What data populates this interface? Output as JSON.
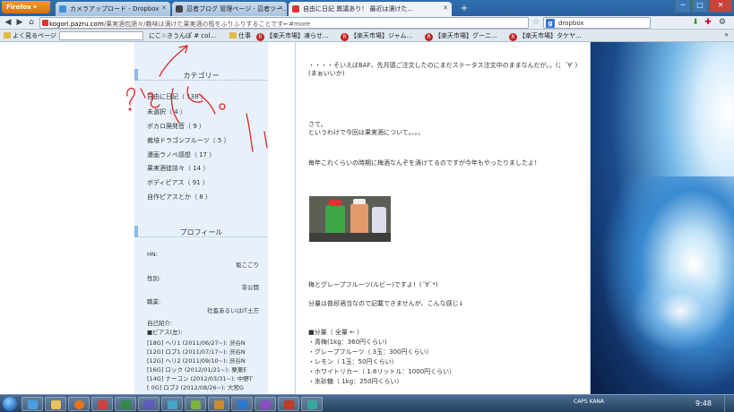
{
  "browser": {
    "menu_label": "Firefox",
    "tabs": [
      {
        "label": "カメラアップロード - Dropbox",
        "state": "bg"
      },
      {
        "label": "忍者ブログ 管理ページ - 忍者ツー...",
        "state": "bg"
      },
      {
        "label": "自由に日記 異議あり！ 最近は漬けた...",
        "state": "active"
      }
    ],
    "new_tab": "+",
    "window_buttons": [
      "─",
      "□",
      "✕"
    ]
  },
  "navbar": {
    "url_domain": "kogori.pazru.com",
    "url_rest": "/果実酒包諦々/趣味は漬けた果実酒の瓶をふりふりすることです←#more",
    "search_text": "dropbox"
  },
  "bookmarks": [
    {
      "label": "よく見るページ",
      "type": "plain"
    },
    {
      "label": "にこ☆きうんぽ # col...",
      "type": "plain"
    },
    {
      "label": "仕事",
      "type": "folder"
    },
    {
      "label": "【楽天市場】凍らせ...",
      "type": "rakuten"
    },
    {
      "label": "【楽天市場】ジャム...",
      "type": "rakuten"
    },
    {
      "label": "【楽天市場】グーニ...",
      "type": "rakuten"
    },
    {
      "label": "【楽天市場】タケヤ...",
      "type": "rakuten"
    }
  ],
  "sidebar": {
    "category_title": "カテゴリー",
    "categories": [
      "自由に日記（ 138 ）",
      "未選択（ 4 ）",
      "ボカロ廃発音（ 9 ）",
      "裁培ドラゴンフルーツ（ 5 ）",
      "漫画ラノベ感想（ 17 ）",
      "果実酒徒誌々（ 14 ）",
      "ボディピアス（ 91 ）",
      "自作ピアスとか（ 8 ）"
    ],
    "profile_title": "プロフィール",
    "profile": {
      "hn_label": "HN:",
      "hn_value": "坂こごり",
      "sex_label": "性別:",
      "sex_value": "非公開",
      "job_label": "職業:",
      "job_value": "社畜あるいはIT土方",
      "intro_label": "自己紹介:",
      "piercing_label": "■ピアス(左):",
      "piercings": [
        {
          "left": "[18G] ヘリ1 (2011/06/27~):",
          "right": "渋谷N"
        },
        {
          "left": "[12G] ロブ1 (2011/07/17~):",
          "right": "渋谷N"
        },
        {
          "left": "[12G] ヘリ2 (2011/09/10~):",
          "right": "渋谷N"
        },
        {
          "left": "[16G] ロック (2012/01/21~):",
          "right": "栗東E"
        },
        {
          "left": "[14G] ナーコン (2012/03/31~):",
          "right": "中野T"
        },
        {
          "left": "[ 0G] ロブ2 (2012/08/26~):",
          "right": "大宮G"
        }
      ]
    }
  },
  "content": {
    "lines_top": [
      "・・・・そいえばBAF、先月頭ご注文したのにまだステータス注文中のままなんだが。。(；´∀`)",
      "(まぁいいか)"
    ],
    "lines_mid": [
      "さて。",
      "というわけで今回は果実酒について。。。。"
    ],
    "line_intro": "毎年これくらいの時期に梅酒なんぞを漬けてるのですが今年もやったりましたよ！",
    "photo_caption": "梅とグレープフルーツ(ルビー)ですよ！(´∀`*)",
    "line_note": "分量は普段適当なので記載できませんが、こんな感じ↓",
    "amount_title": "■分量（ 全量 ← ）",
    "amounts": [
      "・青梅(1kg：360円くらい)",
      "・グレープフルーツ（ 3玉：300円くらい）",
      "・レモン（ 1玉：50円くらい）",
      "・ホワイトリカー（ 1.8リットル：1000円くらい）",
      "・氷砂糖（ 1kg：250円くらい）"
    ]
  },
  "taskbar": {
    "tray_text": "CAPS KANA",
    "clock": "9:48"
  },
  "colors": {
    "sidebar_bg": "#e8f1fb",
    "accent": "#8fb8e2",
    "scribble": "#e02020",
    "titlebar": "#2f6fb0"
  }
}
